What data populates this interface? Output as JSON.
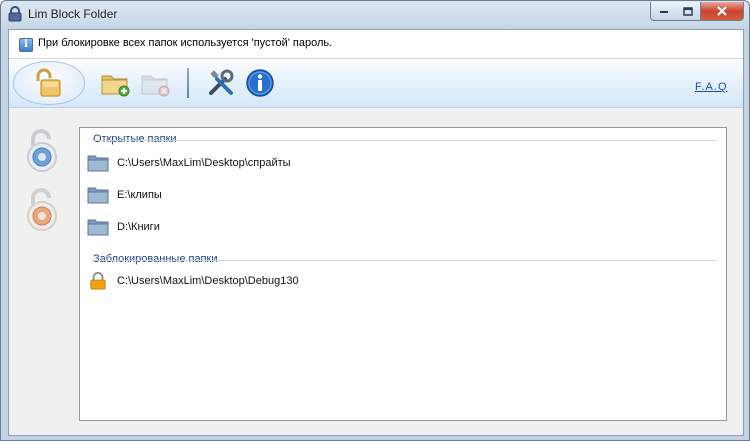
{
  "window": {
    "title": "Lim Block Folder"
  },
  "info": {
    "icon": "info-icon",
    "text": "При блокировке всех папок используется 'пустой' пароль."
  },
  "toolbar": {
    "buttons": [
      {
        "name": "lock-toggle-button",
        "icon": "unlocked-padlock-icon"
      },
      {
        "name": "add-folder-button",
        "icon": "folder-add-icon"
      },
      {
        "name": "remove-folder-button",
        "icon": "folder-remove-icon"
      },
      {
        "name": "settings-button",
        "icon": "tools-icon"
      },
      {
        "name": "about-button",
        "icon": "info-circle-icon"
      }
    ],
    "faq_label": "F.A.Q"
  },
  "open_group": {
    "label": "Открытые папки",
    "items": [
      {
        "path": "C:\\Users\\MaxLim\\Desktop\\спрайты",
        "icon": "folder-icon"
      },
      {
        "path": "E:\\клипы",
        "icon": "folder-icon"
      },
      {
        "path": "D:\\Книги",
        "icon": "folder-icon"
      }
    ]
  },
  "locked_group": {
    "label": "Заблокированные папки",
    "items": [
      {
        "path": "C:\\Users\\MaxLim\\Desktop\\Debug130",
        "icon": "padlock-icon"
      }
    ]
  },
  "colors": {
    "group_label": "#1c3e8a",
    "link": "#1a4db3",
    "lock": "#f0a012"
  }
}
